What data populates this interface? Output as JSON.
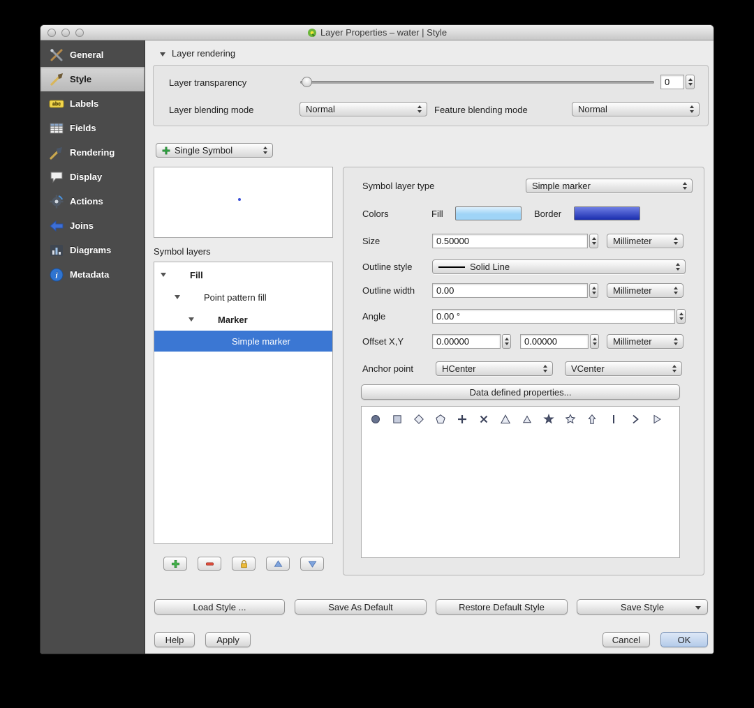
{
  "window": {
    "title": "Layer Properties – water | Style"
  },
  "sidebar": {
    "items": [
      {
        "label": "General",
        "icon": "general-icon",
        "active": false
      },
      {
        "label": "Style",
        "icon": "style-icon",
        "active": true
      },
      {
        "label": "Labels",
        "icon": "labels-icon",
        "active": false
      },
      {
        "label": "Fields",
        "icon": "fields-icon",
        "active": false
      },
      {
        "label": "Rendering",
        "icon": "rendering-icon",
        "active": false
      },
      {
        "label": "Display",
        "icon": "display-icon",
        "active": false
      },
      {
        "label": "Actions",
        "icon": "actions-icon",
        "active": false
      },
      {
        "label": "Joins",
        "icon": "joins-icon",
        "active": false
      },
      {
        "label": "Diagrams",
        "icon": "diagrams-icon",
        "active": false
      },
      {
        "label": "Metadata",
        "icon": "metadata-icon",
        "active": false
      }
    ]
  },
  "layer_rendering": {
    "section_label": "Layer rendering",
    "transparency_label": "Layer transparency",
    "transparency_value": "0",
    "blending_mode_label": "Layer blending mode",
    "blending_mode_value": "Normal",
    "feature_blending_label": "Feature blending mode",
    "feature_blending_value": "Normal"
  },
  "renderer": {
    "value": "Single Symbol"
  },
  "symbol_tree": {
    "label": "Symbol layers",
    "items": [
      {
        "label": "Fill",
        "level": 0,
        "bold": true,
        "expanded": true,
        "selected": false
      },
      {
        "label": "Point pattern fill",
        "level": 1,
        "bold": false,
        "expanded": true,
        "selected": false
      },
      {
        "label": "Marker",
        "level": 2,
        "bold": true,
        "expanded": true,
        "selected": false
      },
      {
        "label": "Simple marker",
        "level": 3,
        "bold": false,
        "expanded": false,
        "selected": true
      }
    ],
    "buttons": [
      {
        "name": "add-symbol-layer-button",
        "icon": "add-icon"
      },
      {
        "name": "remove-symbol-layer-button",
        "icon": "remove-icon"
      },
      {
        "name": "lock-symbol-layer-button",
        "icon": "lock-icon"
      },
      {
        "name": "move-up-symbol-layer-button",
        "icon": "arrow-up-icon"
      },
      {
        "name": "move-down-symbol-layer-button",
        "icon": "arrow-down-icon"
      }
    ]
  },
  "symbol_properties": {
    "layer_type_label": "Symbol layer type",
    "layer_type_value": "Simple marker",
    "colors_label": "Colors",
    "fill_label": "Fill",
    "border_label": "Border",
    "fill_color": "#9fd4f7",
    "border_color": "#2038d5",
    "size_label": "Size",
    "size_value": "0.50000",
    "size_unit": "Millimeter",
    "outline_style_label": "Outline style",
    "outline_style_value": "Solid Line",
    "outline_width_label": "Outline width",
    "outline_width_value": "0.00",
    "outline_width_unit": "Millimeter",
    "angle_label": "Angle",
    "angle_value": "0.00 °",
    "offset_label": "Offset X,Y",
    "offset_x_value": "0.00000",
    "offset_y_value": "0.00000",
    "offset_unit": "Millimeter",
    "anchor_label": "Anchor point",
    "anchor_h_value": "HCenter",
    "anchor_v_value": "VCenter",
    "data_defined_button_label": "Data defined properties...",
    "marker_shapes": [
      "circle",
      "square",
      "diamond",
      "pentagon",
      "plus",
      "cross",
      "triangle",
      "equilateral-triangle",
      "star-sharp",
      "star",
      "arrow-up",
      "vertical-line",
      "chevron-right",
      "arrowhead-right"
    ]
  },
  "style_actions": {
    "load_style": "Load Style ...",
    "save_as_default": "Save As Default",
    "restore_default": "Restore Default Style",
    "save_style": "Save Style"
  },
  "dialog_actions": {
    "help": "Help",
    "apply": "Apply",
    "cancel": "Cancel",
    "ok": "OK"
  }
}
